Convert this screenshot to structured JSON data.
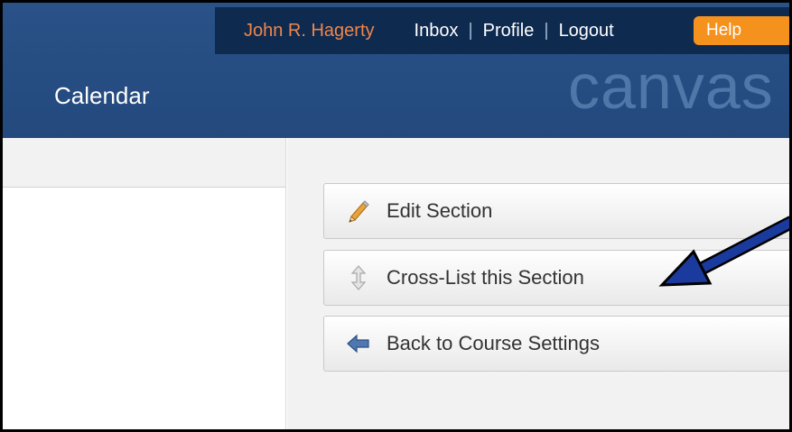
{
  "header": {
    "user_name": "John R. Hagerty",
    "links": [
      "Inbox",
      "Profile",
      "Logout"
    ],
    "separator": "|",
    "help_label": "Help",
    "page_title": "Calendar",
    "logo_text": "canvas"
  },
  "actions": {
    "edit_section": "Edit Section",
    "cross_list": "Cross-List this Section",
    "back_to_settings": "Back to Course Settings"
  },
  "icons": {
    "edit": "pencil-icon",
    "cross_list": "vertical-arrows-icon",
    "back": "left-arrow-icon"
  },
  "colors": {
    "header_bg": "#2a5288",
    "userbar_bg": "#0e2a4f",
    "user_name": "#f0864a",
    "help_button": "#f5921e",
    "annotation_arrow": "#1b3a9e"
  }
}
